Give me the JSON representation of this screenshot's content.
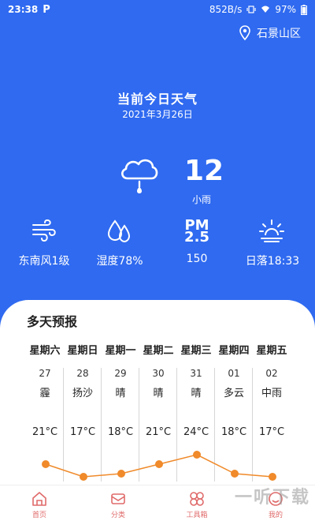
{
  "status_bar": {
    "time": "23:38",
    "app_indicator": "P",
    "network_speed": "852B/s",
    "battery": "97%"
  },
  "header": {
    "location": "石景山区"
  },
  "today": {
    "title": "当前今日天气",
    "date": "2021年3月26日",
    "temperature": "12",
    "condition": "小雨",
    "weather_icon": "cloud-rain-icon"
  },
  "metrics": [
    {
      "icon": "wind-icon",
      "label": "东南风1级"
    },
    {
      "icon": "humidity-icon",
      "label": "湿度78%"
    },
    {
      "icon": "pm25-icon",
      "pm_top": "PM",
      "pm_bottom": "2.5",
      "label": "150"
    },
    {
      "icon": "sunset-icon",
      "label": "日落18:33"
    }
  ],
  "forecast": {
    "title": "多天预报",
    "days": [
      {
        "weekday": "星期六",
        "date": "27",
        "weather": "霾",
        "temp": "21°C",
        "temp_value": 21
      },
      {
        "weekday": "星期日",
        "date": "28",
        "weather": "扬沙",
        "temp": "17°C",
        "temp_value": 17
      },
      {
        "weekday": "星期一",
        "date": "29",
        "weather": "晴",
        "temp": "18°C",
        "temp_value": 18
      },
      {
        "weekday": "星期二",
        "date": "30",
        "weather": "晴",
        "temp": "21°C",
        "temp_value": 21
      },
      {
        "weekday": "星期三",
        "date": "31",
        "weather": "晴",
        "temp": "24°C",
        "temp_value": 24
      },
      {
        "weekday": "星期四",
        "date": "01",
        "weather": "多云",
        "temp": "18°C",
        "temp_value": 18
      },
      {
        "weekday": "星期五",
        "date": "02",
        "weather": "中雨",
        "temp": "17°C",
        "temp_value": 17
      }
    ]
  },
  "bottom_nav": [
    {
      "label": "首页",
      "icon": "home-icon"
    },
    {
      "label": "分类",
      "icon": "category-icon"
    },
    {
      "label": "工具箱",
      "icon": "toolbox-icon"
    },
    {
      "label": "我的",
      "icon": "profile-icon"
    }
  ],
  "watermark": "一听下载",
  "colors": {
    "primary_blue": "#2f6af0",
    "accent_orange": "#f08a2a",
    "nav_red": "#e06a6a"
  }
}
